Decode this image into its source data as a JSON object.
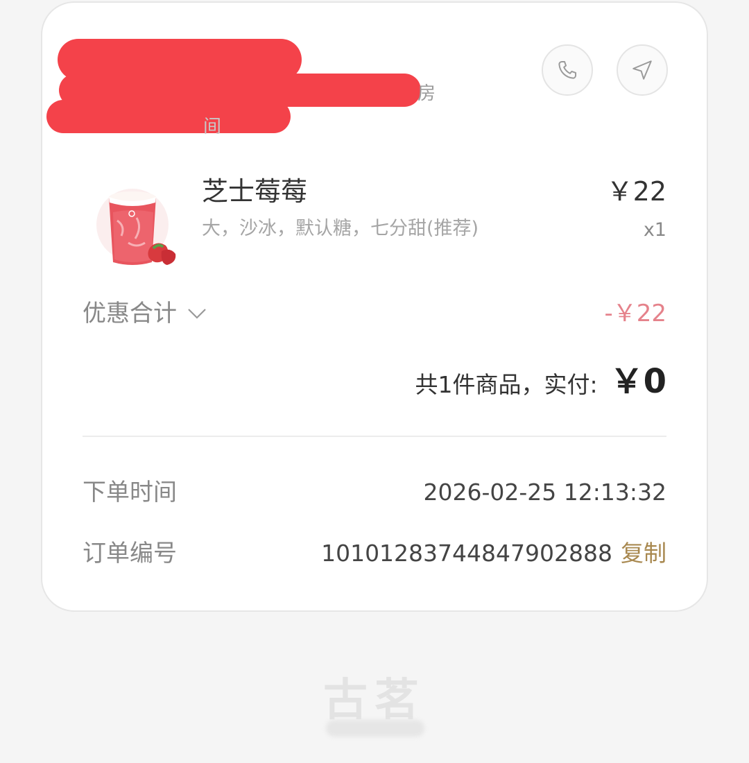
{
  "address": {
    "line1_fragment": "房",
    "line2_fragment": "间"
  },
  "actions": {
    "call_icon": "phone-icon",
    "navigate_icon": "navigation-arrow-icon"
  },
  "product": {
    "name": "芝士莓莓",
    "spec": "大，沙冰，默认糖，七分甜(推荐)",
    "price": "￥22",
    "quantity": "x1"
  },
  "discount": {
    "label": "优惠合计",
    "value": "-￥22"
  },
  "total": {
    "label": "共1件商品，实付:",
    "amount": "￥0"
  },
  "order_info": {
    "time_label": "下单时间",
    "time_value": "2026-02-25 12:13:32",
    "number_label": "订单编号",
    "number_value": "10101283744847902888",
    "copy_label": "复制"
  },
  "brand": {
    "name": "古茗"
  },
  "colors": {
    "redaction": "#f4424a",
    "discount": "#e5828b",
    "copy_link": "#a8884f",
    "background": "#f5f5f5"
  }
}
